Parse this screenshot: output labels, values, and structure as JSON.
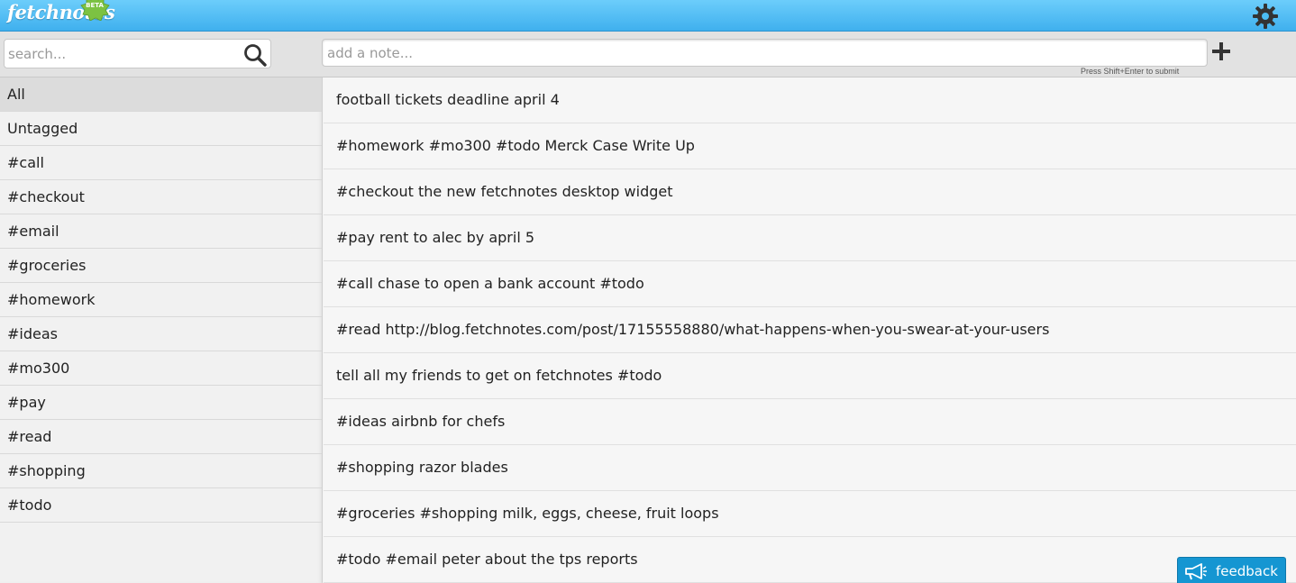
{
  "app": {
    "logo_text": "fetchnotes",
    "badge": "BETA"
  },
  "icons": {
    "settings": "gear-icon",
    "search": "search-icon",
    "add": "plus-icon",
    "feedback": "megaphone-icon"
  },
  "colors": {
    "header_blue": "#4bbcf2",
    "feedback_blue": "#1596d2",
    "badge_green": "#7cc242"
  },
  "search": {
    "placeholder": "search...",
    "value": ""
  },
  "composer": {
    "placeholder": "add a note...",
    "value": "",
    "hint": "Press Shift+Enter to submit"
  },
  "sidebar": {
    "selected": "All",
    "items": [
      {
        "label": "All"
      },
      {
        "label": "Untagged"
      },
      {
        "label": "#call"
      },
      {
        "label": "#checkout"
      },
      {
        "label": "#email"
      },
      {
        "label": "#groceries"
      },
      {
        "label": "#homework"
      },
      {
        "label": "#ideas"
      },
      {
        "label": "#mo300"
      },
      {
        "label": "#pay"
      },
      {
        "label": "#read"
      },
      {
        "label": "#shopping"
      },
      {
        "label": "#todo"
      }
    ]
  },
  "notes": [
    {
      "text": "football tickets deadline april 4"
    },
    {
      "text": "#homework #mo300 #todo Merck Case Write Up"
    },
    {
      "text": "#checkout the new fetchnotes desktop widget"
    },
    {
      "text": "#pay rent to alec by april 5"
    },
    {
      "text": "#call chase to open a bank account #todo"
    },
    {
      "text": "#read http://blog.fetchnotes.com/post/17155558880/what-happens-when-you-swear-at-your-users"
    },
    {
      "text": "tell all my friends to get on fetchnotes #todo"
    },
    {
      "text": "#ideas airbnb for chefs"
    },
    {
      "text": "#shopping razor blades"
    },
    {
      "text": "#groceries #shopping milk, eggs, cheese, fruit loops"
    },
    {
      "text": "#todo #email peter about the tps reports"
    }
  ],
  "feedback": {
    "label": "feedback"
  }
}
